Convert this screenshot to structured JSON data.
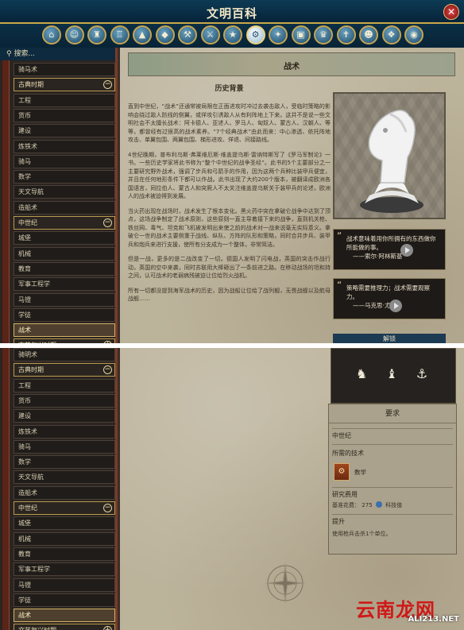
{
  "window": {
    "title": "文明百科",
    "close_glyph": "✕"
  },
  "categories": [
    {
      "icon": "home-icon",
      "glyph": "⌂"
    },
    {
      "icon": "leader-icon",
      "glyph": "☺"
    },
    {
      "icon": "civilization-icon",
      "glyph": "♜"
    },
    {
      "icon": "city-state-icon",
      "glyph": "♖"
    },
    {
      "icon": "terrain-icon",
      "glyph": "▲"
    },
    {
      "icon": "resource-icon",
      "glyph": "◆"
    },
    {
      "icon": "improvement-icon",
      "glyph": "⚒"
    },
    {
      "icon": "unit-icon",
      "glyph": "⚔"
    },
    {
      "icon": "promotion-icon",
      "glyph": "★"
    },
    {
      "icon": "technology-icon",
      "glyph": "⚙"
    },
    {
      "icon": "policy-icon",
      "glyph": "✦"
    },
    {
      "icon": "building-icon",
      "glyph": "▣"
    },
    {
      "icon": "wonder-icon",
      "glyph": "♛"
    },
    {
      "icon": "religion-icon",
      "glyph": "✝"
    },
    {
      "icon": "specialist-icon",
      "glyph": "☻"
    },
    {
      "icon": "world-congress-icon",
      "glyph": "❖"
    },
    {
      "icon": "globe-icon",
      "glyph": "◉"
    }
  ],
  "sidebar": {
    "search_label": "搜索...",
    "items_top": [
      {
        "label": "骑马术",
        "type": "item"
      },
      {
        "label": "古典时期",
        "type": "era",
        "toggle": "−"
      },
      {
        "label": "工程",
        "type": "item"
      },
      {
        "label": "货币",
        "type": "item"
      },
      {
        "label": "建设",
        "type": "item"
      },
      {
        "label": "炼铁术",
        "type": "item"
      },
      {
        "label": "骑马",
        "type": "item"
      },
      {
        "label": "数学",
        "type": "item"
      },
      {
        "label": "天文导航",
        "type": "item"
      },
      {
        "label": "造船术",
        "type": "item"
      },
      {
        "label": "中世纪",
        "type": "era",
        "toggle": "−"
      },
      {
        "label": "城堡",
        "type": "item"
      },
      {
        "label": "机械",
        "type": "item"
      },
      {
        "label": "教育",
        "type": "item"
      },
      {
        "label": "军事工程学",
        "type": "item"
      },
      {
        "label": "马镫",
        "type": "item"
      },
      {
        "label": "学徒",
        "type": "item"
      },
      {
        "label": "战术",
        "type": "selected"
      },
      {
        "label": "文艺复兴时期",
        "type": "era",
        "toggle": "+"
      }
    ],
    "items_bottom": [
      {
        "label": "骑明术",
        "type": "item"
      },
      {
        "label": "古典时期",
        "type": "era",
        "toggle": "−"
      },
      {
        "label": "工程",
        "type": "item"
      },
      {
        "label": "货币",
        "type": "item"
      },
      {
        "label": "建设",
        "type": "item"
      },
      {
        "label": "炼铁术",
        "type": "item"
      },
      {
        "label": "骑马",
        "type": "item"
      },
      {
        "label": "数学",
        "type": "item"
      },
      {
        "label": "天文导航",
        "type": "item"
      },
      {
        "label": "造船术",
        "type": "item"
      },
      {
        "label": "中世纪",
        "type": "era",
        "toggle": "−"
      },
      {
        "label": "城堡",
        "type": "item"
      },
      {
        "label": "机械",
        "type": "item"
      },
      {
        "label": "教育",
        "type": "item"
      },
      {
        "label": "军事工程学",
        "type": "item"
      },
      {
        "label": "马镫",
        "type": "item"
      },
      {
        "label": "学徒",
        "type": "item"
      },
      {
        "label": "战术",
        "type": "selected"
      },
      {
        "label": "文艺复兴时期",
        "type": "era",
        "toggle": "+"
      }
    ]
  },
  "article": {
    "title": "战术",
    "history_heading": "历史背景",
    "paragraphs": [
      "直到中世纪，“战术”还通常被局限在正面进攻时冲过去袭击敌人，受临时策略的影响会绕过敌人防线的侧翼，或佯攻引诱敌人从有利阵地上下来。这并不是说一些文明社会不太擅长战术：阿卡德人、亚述人、罗马人、匈奴人、蒙古人、汉朝人、等等，都曾经有过很高的战术素养。“7个经典战术”由此而来：中心渗透、依托阵地攻击、单翼包围、两翼包围、梯形进攻、佯退、间接路线。",
      "4世纪晚期，普布利乌斯·弗莱维厄斯·维盖提乌斯·雷纳特斯写了《罗马军制论》一书。一些历史学家将此书称为“整个中世纪的战争圣经”。此书的5个主要部分之一主要研究野外战术，强调了步兵和弓箭手的作用，因为这两个兵种比装甲兵便宜，并且在任何地形条件下都可以作战。此书出现了大约200个版本，被翻译成欧洲各国语言，同拉伯人、蒙古人和突厥人不太关注维盖提乌斯关于装甲兵的论述，欧洲人的战术被迫得到发展。",
      "当火药出现在战场时，战术发生了根本变化。黑火药中突在拿破仑战争中达到了顶点，这场战争制定了战术原则，这些原则一直主导着接下来的战争，直到机关枪、铁丝网、毒气、坦克和飞机被发明出来使之前的战术对一战来说毫无实际意义。拿破仑一世的战术主要侧重于战线、纵队、方阵的队形和策略，同时合并步兵、装甲兵和炮兵来进行支援，使所有分支成为一个整体，非常简洁。",
      "但是一战，更多的是二战改变了一切。德国人发明了闪电战，英国的突击作战行动，英国的空中来袭，同时苏联用大棒砸出了一条前进之路。在移动战场的坦和持之间，认可战术的老弱病残被迫让位给烈火战机。",
      "所有一切都没提到海军战术的历史，因为战船让位给了战列舰，无畏战舰以及航母战舰……"
    ],
    "quotes": [
      {
        "text": "战术意味着用你所拥有的东西做你所能做的事。",
        "author": "——索尔·阿林斯基"
      },
      {
        "text": "策略需要推理力；战术需要观察力。",
        "author": "——马克思·尤伟"
      }
    ],
    "unlocks_heading": "解锁",
    "unlock_icons": [
      {
        "icon": "knight-unit-icon",
        "glyph": "♞"
      },
      {
        "icon": "pikeman-unit-icon",
        "glyph": "♝"
      },
      {
        "icon": "trireme-unit-icon",
        "glyph": "⚓"
      }
    ],
    "requirements": {
      "heading": "要求",
      "era_label": "中世纪",
      "required_tech_label": "所需的技术",
      "required_tech": "数学",
      "research_cost_label": "研究费用",
      "base_cost_label": "基准花费：",
      "base_cost_value": "275",
      "science_label": "科技值",
      "upgrade_label": "提升",
      "upgrade_text": "使用枪兵击杀1个单位。"
    }
  },
  "watermark": {
    "main": "云南龙网",
    "sub": "ALI213.NET"
  }
}
